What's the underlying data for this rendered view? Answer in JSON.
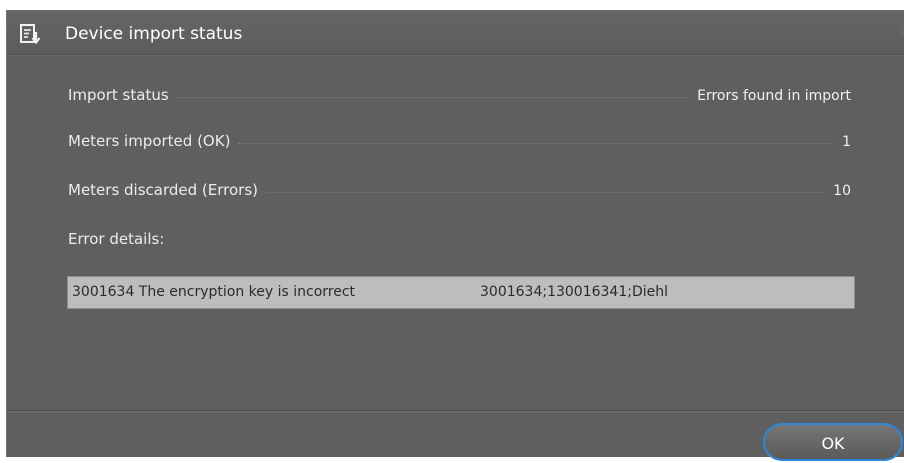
{
  "dialog": {
    "title": "Device import status",
    "icon": "import-list-icon",
    "close_glyph": "×"
  },
  "fields": [
    {
      "label": "Import status",
      "value": "Errors found in import"
    },
    {
      "label": "Meters imported (OK)",
      "value": "1"
    },
    {
      "label": "Meters discarded (Errors)",
      "value": "10"
    }
  ],
  "error_details": {
    "label": "Error details:",
    "rows": [
      {
        "message": "3001634 The encryption key is incorrect",
        "data": "3001634;130016341;Diehl"
      }
    ]
  },
  "footer": {
    "ok_label": "OK"
  },
  "colors": {
    "dialog_bg": "#5f5f5f",
    "list_bg": "#bdbdbd",
    "accent": "#2f86d6"
  }
}
